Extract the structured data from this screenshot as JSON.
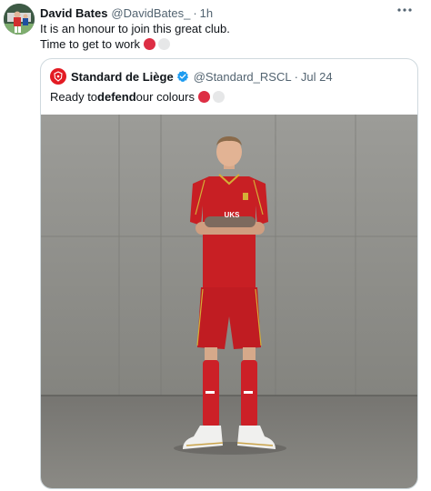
{
  "tweet": {
    "author_name": "David Bates",
    "author_handle": "@DavidBates_",
    "separator": "·",
    "time": "1h",
    "line1": "It is an honour to join this great club.",
    "line2": "Time to get to work",
    "more_icon": "more-horizontal-icon"
  },
  "quote": {
    "author_name": "Standard de Liège",
    "author_handle": "@Standard_RSCL",
    "separator": "·",
    "time": "Jul 24",
    "text_before": "Ready to ",
    "text_bold": "defend",
    "text_after": " our colours",
    "logo_icon": "standard-liege-crest-icon",
    "verified_icon": "verified-badge-icon",
    "verified_color": "#1d9bf0"
  },
  "colors": {
    "accent_red": "#dd2e44",
    "text_primary": "#0f1419",
    "text_secondary": "#536471",
    "border": "#cfd9de"
  }
}
